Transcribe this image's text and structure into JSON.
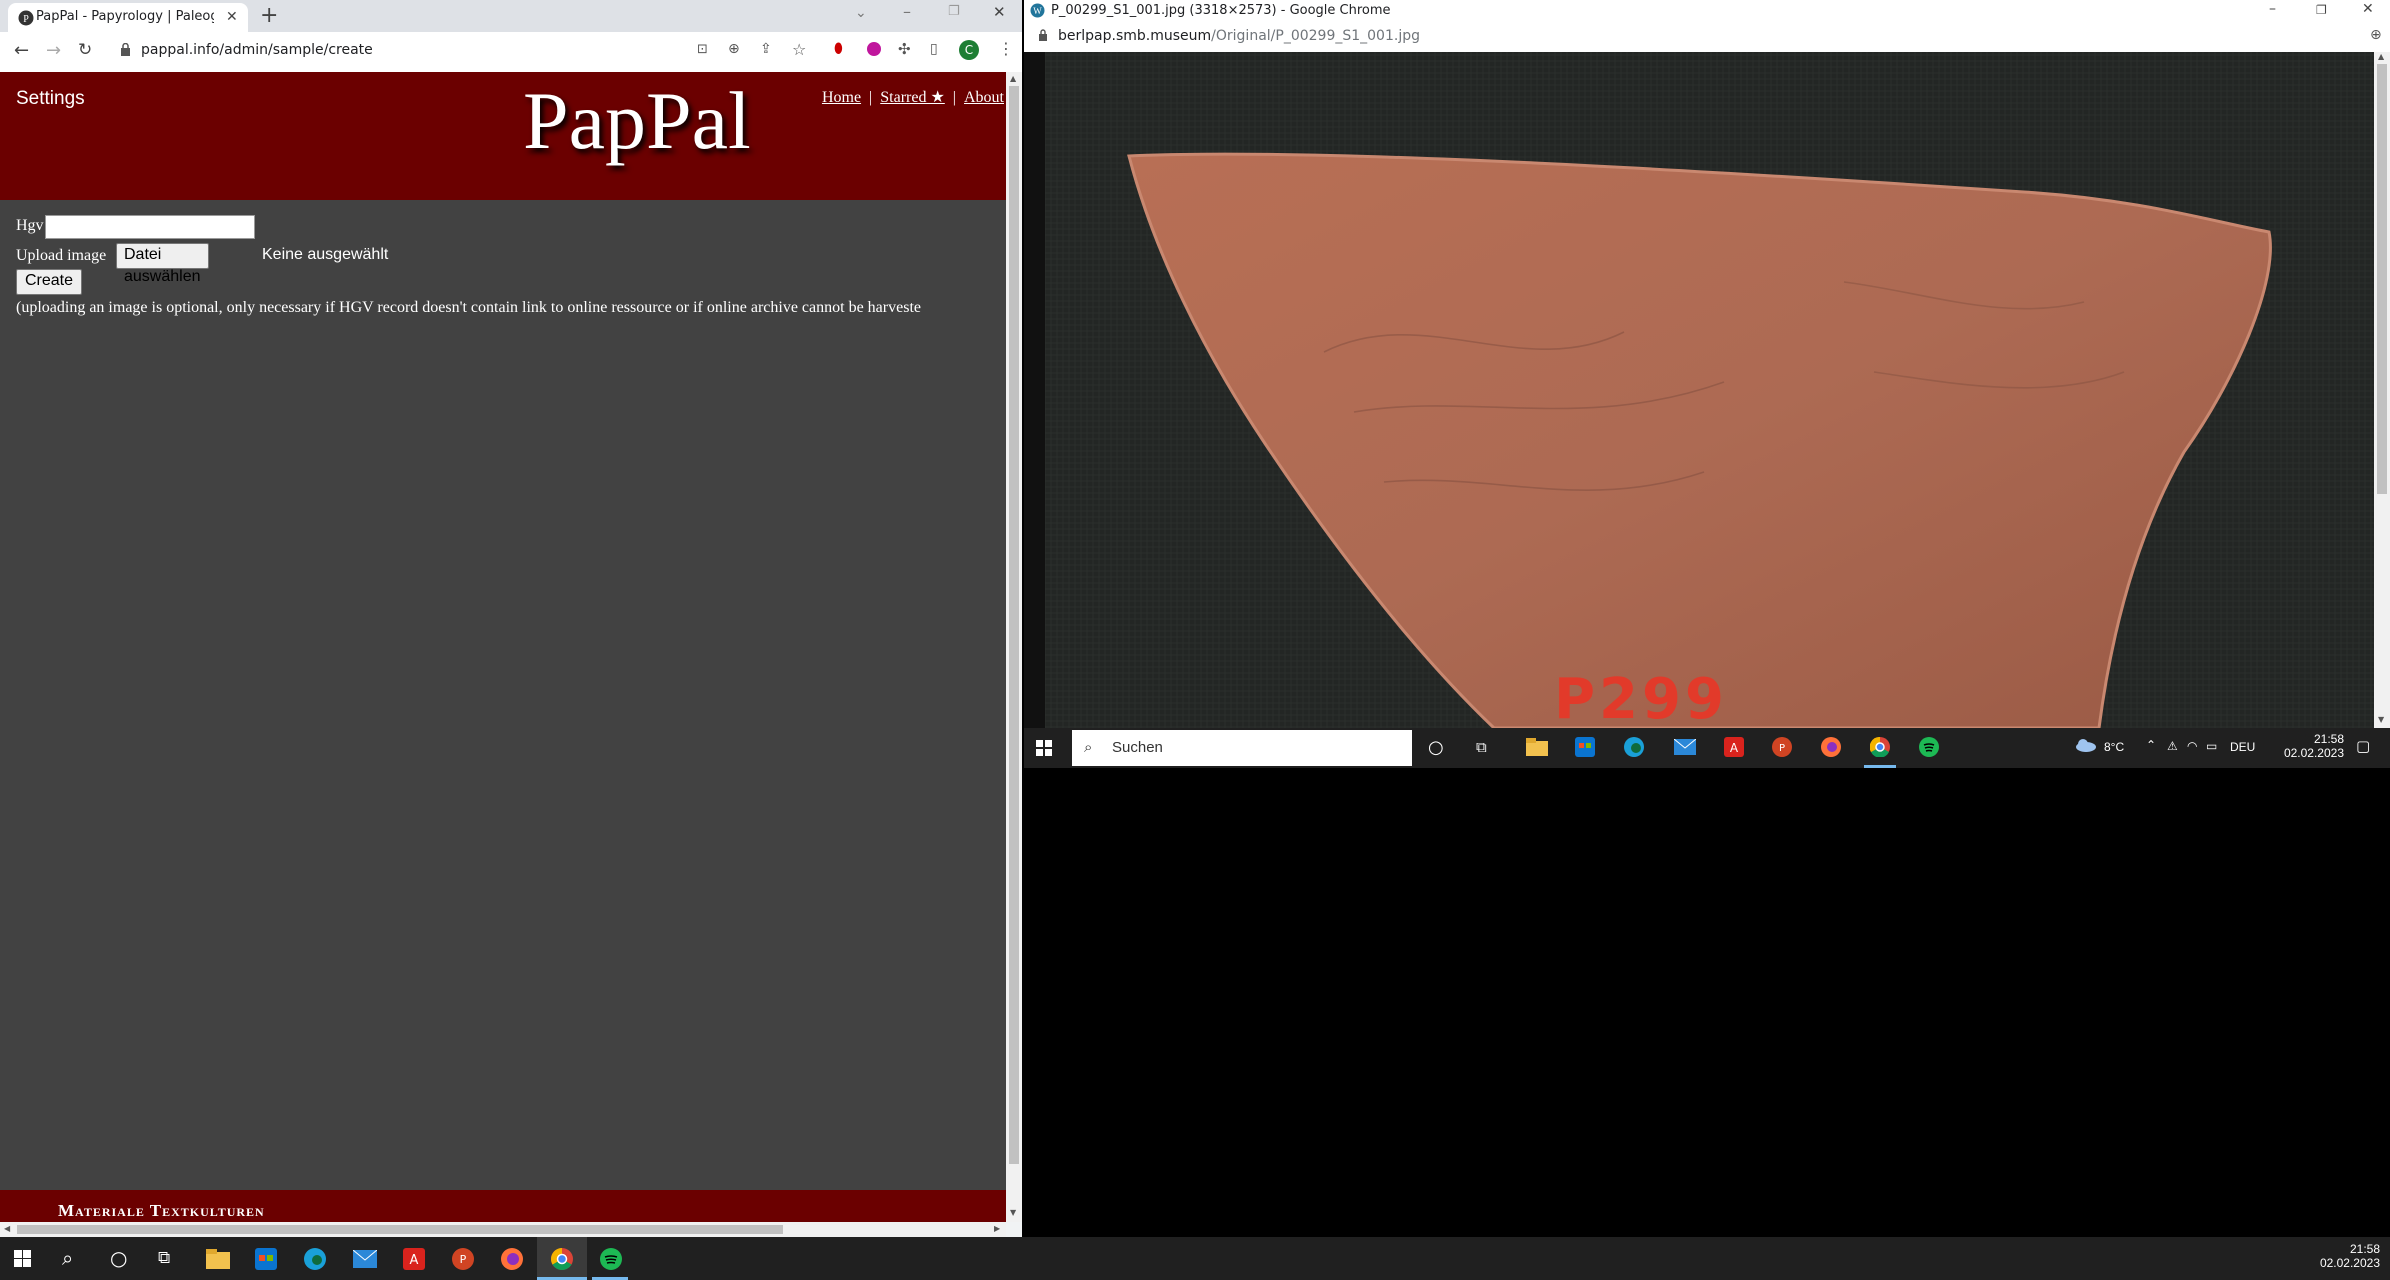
{
  "left_browser": {
    "tab_title": "PapPal - Papyrology | Paleograph",
    "url": "pappal.info/admin/sample/create",
    "profile_initial": "C"
  },
  "site": {
    "settings_label": "Settings",
    "logo": "PapPal",
    "nav": [
      "Home",
      "Starred ★",
      "About"
    ],
    "form": {
      "hgv_label": "Hgv",
      "hgv_value": "",
      "upload_label": "Upload image",
      "file_button": "Datei auswählen",
      "file_status": "Keine ausgewählt",
      "create_button": "Create",
      "note": "(uploading an image is optional, only necessary if HGV record doesn't contain link to online ressource or if online archive cannot be harveste"
    },
    "footer_text": "Materiale Textkulturen"
  },
  "right_browser": {
    "window_title": "P_00299_S1_001.jpg (3318×2573) - Google Chrome",
    "url_host": "berlpap.smb.museum",
    "url_path": "/Original/P_00299_S1_001.jpg",
    "image_mark": "P299"
  },
  "right_taskbar": {
    "search_placeholder": "Suchen",
    "weather": "8°C",
    "language": "DEU",
    "time": "21:58",
    "date": "02.02.2023"
  },
  "taskbar": {
    "time": "21:58",
    "date": "02.02.2023"
  }
}
